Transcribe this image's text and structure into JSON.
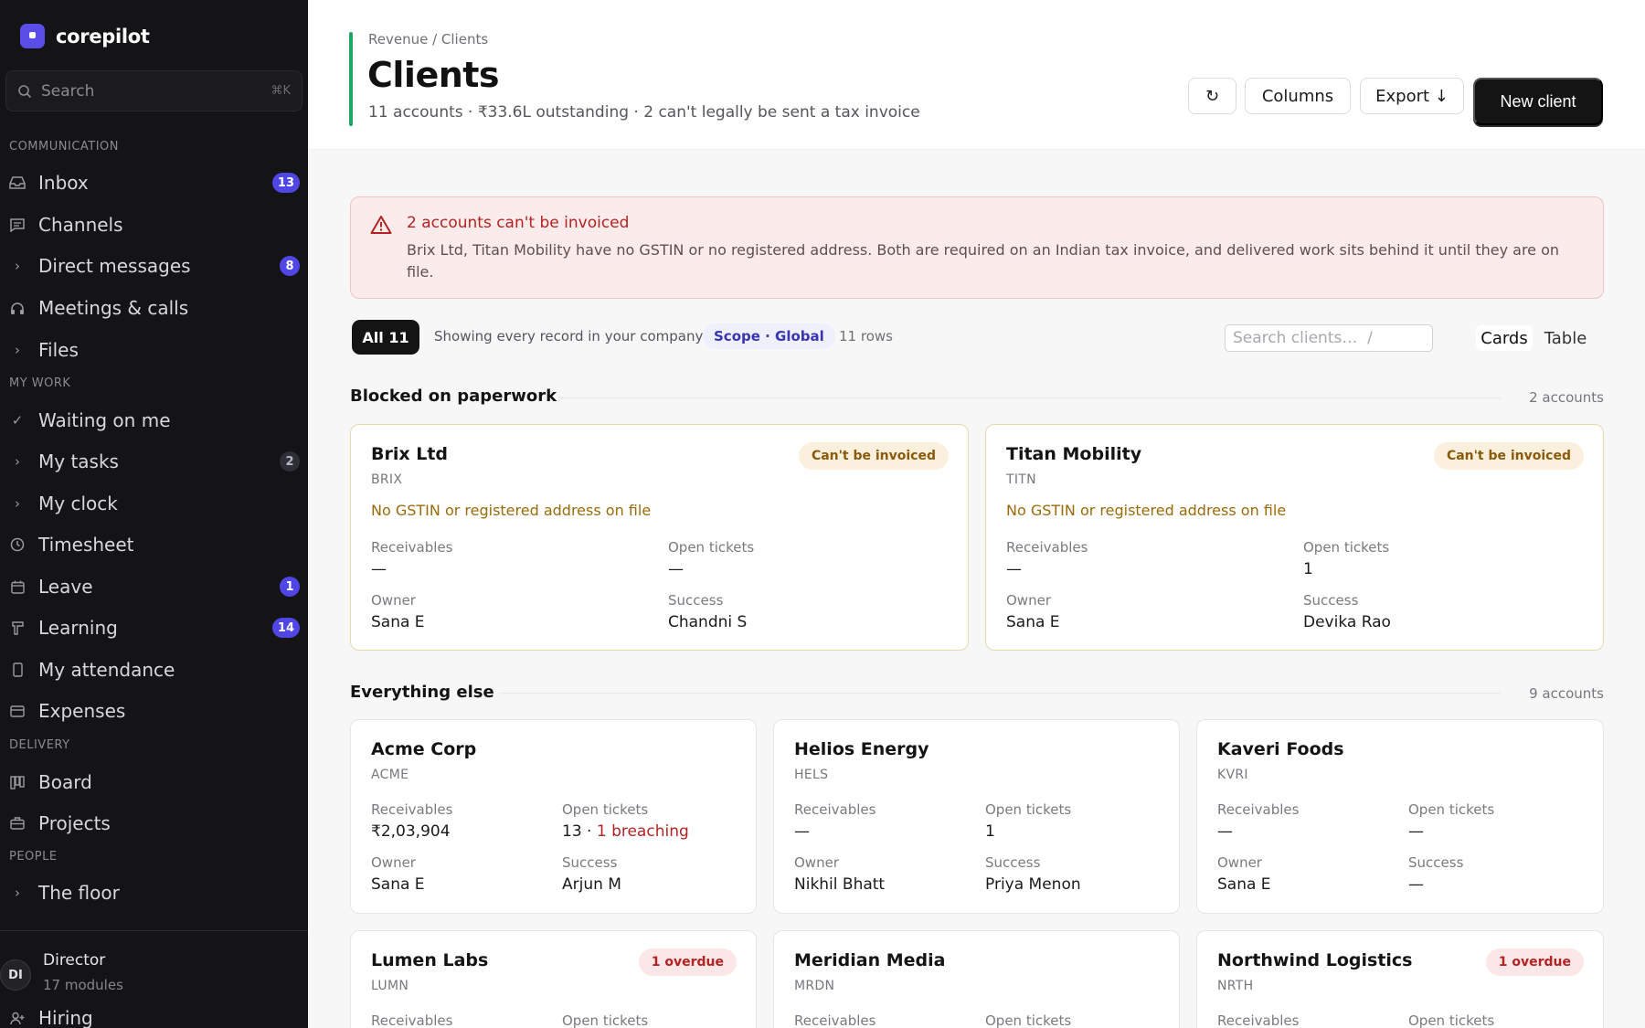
{
  "sidebar": {
    "brand": "corepilot",
    "search": {
      "placeholder": "Search",
      "shortcut": "⌘K"
    },
    "sections": {
      "communication": "COMMUNICATION",
      "my_work": "MY WORK",
      "delivery": "DELIVERY",
      "people": "PEOPLE"
    },
    "items": {
      "inbox": {
        "label": "Inbox",
        "badge": "13",
        "icon": "inbox-icon"
      },
      "channels": {
        "label": "Channels",
        "icon": "chat-icon"
      },
      "direct_messages": {
        "label": "Direct messages",
        "badge": "8",
        "icon": "chevron-right-icon"
      },
      "meetings": {
        "label": "Meetings & calls",
        "icon": "headset-icon"
      },
      "files": {
        "label": "Files",
        "icon": "chevron-right-icon"
      },
      "waiting": {
        "label": "Waiting on me",
        "icon": "check-icon"
      },
      "my_tasks": {
        "label": "My tasks",
        "badge": "2",
        "icon": "chevron-right-icon"
      },
      "my_clock": {
        "label": "My clock",
        "icon": "chevron-right-icon"
      },
      "timesheet": {
        "label": "Timesheet",
        "icon": "clock-icon"
      },
      "leave": {
        "label": "Leave",
        "badge": "1",
        "icon": "calendar-icon"
      },
      "learning": {
        "label": "Learning",
        "badge": "14",
        "icon": "book-icon"
      },
      "attendance": {
        "label": "My attendance",
        "icon": "phone-icon"
      },
      "expenses": {
        "label": "Expenses",
        "icon": "card-icon"
      },
      "board": {
        "label": "Board",
        "icon": "board-icon"
      },
      "projects": {
        "label": "Projects",
        "icon": "briefcase-icon"
      },
      "the_floor": {
        "label": "The floor",
        "icon": "chevron-right-icon"
      },
      "hiring": {
        "label": "Hiring",
        "icon": "user-plus-icon"
      }
    },
    "user": {
      "initials": "DI",
      "role": "Director",
      "sub": "17 modules"
    }
  },
  "header": {
    "breadcrumb": "Revenue / Clients",
    "title": "Clients",
    "subtitle": "11 accounts · ₹33.6L outstanding · 2 can't legally be sent a tax invoice",
    "buttons": {
      "refresh": "↻",
      "columns": "Columns",
      "export": "Export ↓",
      "new_client": "New client"
    }
  },
  "alert": {
    "title": "2 accounts can't be invoiced",
    "body": "Brix Ltd, Titan Mobility have no GSTIN or no registered address. Both are required on an Indian tax invoice, and delivered work sits behind it until they are on file."
  },
  "filters": {
    "all": "All 11",
    "note": "Showing every record in your company",
    "scope": "Scope · Global",
    "rows": "11 rows",
    "search_placeholder": "Search clients…  /",
    "view_cards": "Cards",
    "view_table": "Table"
  },
  "labels": {
    "receivables": "Receivables",
    "open_tickets": "Open tickets",
    "owner": "Owner",
    "success": "Success"
  },
  "groups": {
    "blocked": {
      "title": "Blocked on paperwork",
      "count": "2 accounts"
    },
    "else": {
      "title": "Everything else",
      "count": "9 accounts"
    }
  },
  "blocked_cards": [
    {
      "name": "Brix Ltd",
      "code": "BRIX",
      "pill": "Can't be invoiced",
      "warn": "No GSTIN or registered address on file",
      "receivables": "—",
      "tickets": "—",
      "owner": "Sana E",
      "success": "Chandni S"
    },
    {
      "name": "Titan Mobility",
      "code": "TITN",
      "pill": "Can't be invoiced",
      "warn": "No GSTIN or registered address on file",
      "receivables": "—",
      "tickets": "1",
      "owner": "Sana E",
      "success": "Devika Rao"
    }
  ],
  "cards": [
    {
      "name": "Acme Corp",
      "code": "ACME",
      "receivables": "₹2,03,904",
      "tickets": "13 · ",
      "breach": "1 breaching",
      "owner": "Sana E",
      "success": "Arjun M"
    },
    {
      "name": "Helios Energy",
      "code": "HELS",
      "receivables": "—",
      "tickets": "1",
      "owner": "Nikhil Bhatt",
      "success": "Priya Menon"
    },
    {
      "name": "Kaveri Foods",
      "code": "KVRI",
      "receivables": "—",
      "tickets": "—",
      "owner": "Sana E",
      "success": "—"
    },
    {
      "name": "Lumen Labs",
      "code": "LUMN",
      "pill": "1 overdue"
    },
    {
      "name": "Meridian Media",
      "code": "MRDN"
    },
    {
      "name": "Northwind Logistics",
      "code": "NRTH",
      "pill": "1 overdue"
    }
  ],
  "colors": {
    "accent": "#5b4ee8",
    "badge": "#4f46e5",
    "success_bar": "#22a565",
    "danger": "#b42323",
    "warning": "#9a6b0a"
  }
}
